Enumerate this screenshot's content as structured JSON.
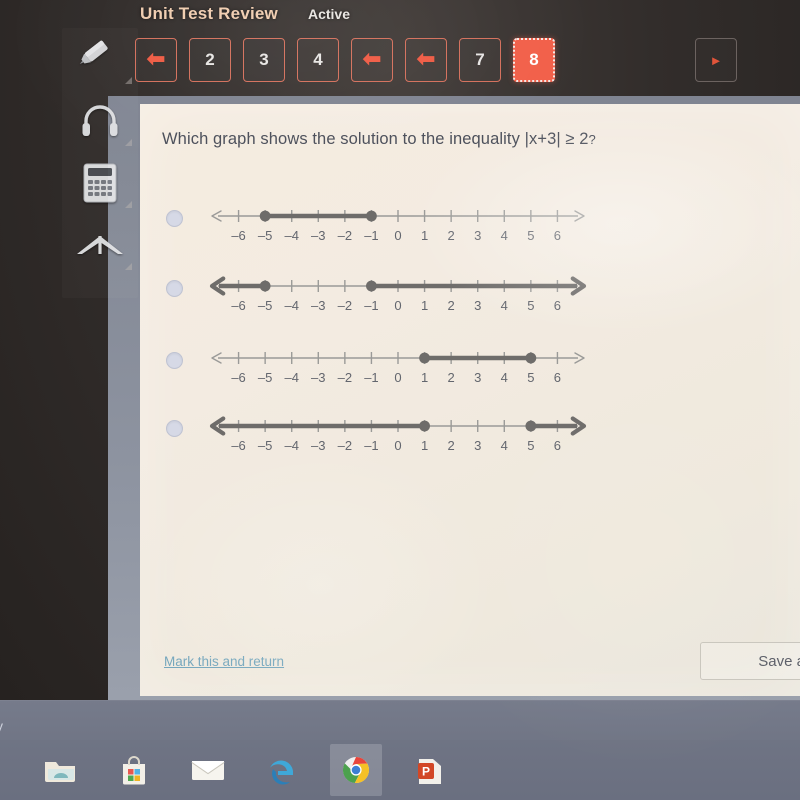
{
  "header": {
    "test_title": "Unit Test Review",
    "status": "Active",
    "pager_items": [
      {
        "label": "back-arrow",
        "type": "arrow-back",
        "active": false
      },
      {
        "label": "2",
        "type": "number",
        "active": false
      },
      {
        "label": "3",
        "type": "number",
        "active": false
      },
      {
        "label": "4",
        "type": "number",
        "active": false
      },
      {
        "label": "back-arrow",
        "type": "arrow-back",
        "active": false
      },
      {
        "label": "back-arrow",
        "type": "arrow-back",
        "active": false
      },
      {
        "label": "7",
        "type": "number",
        "active": false
      },
      {
        "label": "8",
        "type": "number",
        "active": true
      }
    ],
    "next_label": "next-arrow",
    "accent_color": "#f2604a",
    "title_color": "#f0cdb0"
  },
  "tools": [
    {
      "name": "highlighter-icon",
      "label": "Highlighter"
    },
    {
      "name": "headphones-icon",
      "label": "Audio"
    },
    {
      "name": "calculator-icon",
      "label": "Calculator"
    },
    {
      "name": "collapse-icon",
      "label": "Collapse"
    }
  ],
  "question": {
    "prefix": "Which graph shows the solution to the inequality ",
    "expression": "|x+3| ≥ 2",
    "suffix": "?"
  },
  "chart_data": [
    {
      "type": "numberline",
      "option_index": 0,
      "xlim": [
        -7,
        7
      ],
      "tick_labels": [
        "–6",
        "–5",
        "–4",
        "–3",
        "–2",
        "–1",
        "0",
        "1",
        "2",
        "3",
        "4",
        "5",
        "6"
      ],
      "ticks": [
        -6,
        -5,
        -4,
        -3,
        -2,
        -1,
        0,
        1,
        2,
        3,
        4,
        5,
        6
      ],
      "segments": [
        {
          "from": -5,
          "to": -1,
          "closed_left": true,
          "closed_right": true
        }
      ],
      "rays": [],
      "selected": false
    },
    {
      "type": "numberline",
      "option_index": 1,
      "xlim": [
        -7,
        7
      ],
      "tick_labels": [
        "–6",
        "–5",
        "–4",
        "–3",
        "–2",
        "–1",
        "0",
        "1",
        "2",
        "3",
        "4",
        "5",
        "6"
      ],
      "ticks": [
        -6,
        -5,
        -4,
        -3,
        -2,
        -1,
        0,
        1,
        2,
        3,
        4,
        5,
        6
      ],
      "segments": [],
      "rays": [
        {
          "from": -5,
          "direction": "left",
          "closed": true
        },
        {
          "from": -1,
          "direction": "right",
          "closed": true
        }
      ],
      "selected": false
    },
    {
      "type": "numberline",
      "option_index": 2,
      "xlim": [
        -7,
        7
      ],
      "tick_labels": [
        "–6",
        "–5",
        "–4",
        "–3",
        "–2",
        "–1",
        "0",
        "1",
        "2",
        "3",
        "4",
        "5",
        "6"
      ],
      "ticks": [
        -6,
        -5,
        -4,
        -3,
        -2,
        -1,
        0,
        1,
        2,
        3,
        4,
        5,
        6
      ],
      "segments": [
        {
          "from": 1,
          "to": 5,
          "closed_left": true,
          "closed_right": true
        }
      ],
      "rays": [],
      "selected": false
    },
    {
      "type": "numberline",
      "option_index": 3,
      "xlim": [
        -7,
        7
      ],
      "tick_labels": [
        "–6",
        "–5",
        "–4",
        "–3",
        "–2",
        "–1",
        "0",
        "1",
        "2",
        "3",
        "4",
        "5",
        "6"
      ],
      "ticks": [
        -6,
        -5,
        -4,
        -3,
        -2,
        -1,
        0,
        1,
        2,
        3,
        4,
        5,
        6
      ],
      "segments": [],
      "rays": [
        {
          "from": 1,
          "direction": "left",
          "closed": true
        },
        {
          "from": 5,
          "direction": "right",
          "closed": true
        }
      ],
      "selected": false
    }
  ],
  "footer": {
    "mark_return_label": "Mark this and return",
    "save_label": "Save and",
    "link_color": "#76a7bd"
  },
  "taskbar": {
    "desktop_text": "y",
    "items": [
      {
        "name": "file-explorer-icon",
        "label": "File Explorer",
        "highlight": false
      },
      {
        "name": "microsoft-store-icon",
        "label": "Microsoft Store",
        "highlight": false
      },
      {
        "name": "mail-icon",
        "label": "Mail",
        "highlight": false
      },
      {
        "name": "edge-icon",
        "label": "Microsoft Edge",
        "highlight": false
      },
      {
        "name": "chrome-icon",
        "label": "Google Chrome",
        "highlight": true
      },
      {
        "name": "powerpoint-icon",
        "label": "PowerPoint",
        "highlight": false
      }
    ]
  }
}
